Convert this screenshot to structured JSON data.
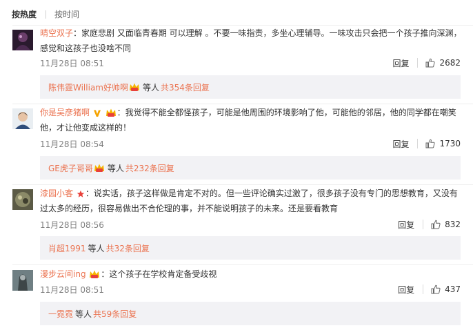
{
  "sort": {
    "hot_label": "按热度",
    "time_label": "按时间"
  },
  "comments": [
    {
      "user": "晴空双子",
      "text": "家庭悲剧 又面临青春期 可以理解 。不要一味指责，多坐心理辅导。一味攻击只会把一个孩子推向深渊，感觉和这孩子也没啥不同",
      "time": "11月28日 08:51",
      "reply_label": "回复",
      "likes": "2682",
      "sub": {
        "user": "陈伟霆William好帅啊",
        "mid": "等人",
        "count": "共354条回复"
      }
    },
    {
      "user": "你是吴彦猪啊",
      "text": "我觉得不能全都怪孩子，可能是他周围的环境影响了他，可能他的邻居，他的同学都在嘲笑他，才让他变成这样的！",
      "time": "11月28日 08:54",
      "reply_label": "回复",
      "likes": "1730",
      "sub": {
        "user": "GE虎子哥哥",
        "mid": "等人",
        "count": "共232条回复"
      }
    },
    {
      "user": "漆园小客",
      "text": "说实话，孩子这样做是肯定不对的。但一些评论确实过激了，很多孩子没有专门的思想教育，又没有过太多的经历，很容易做出不合伦理的事，并不能说明孩子的未来。还是要看教育",
      "time": "11月28日 08:56",
      "reply_label": "回复",
      "likes": "832",
      "sub": {
        "user": "肖超1991",
        "mid": "等人",
        "count": "共32条回复"
      }
    },
    {
      "user": "漫步云间ing",
      "text": "这个孩子在学校肯定备受歧视",
      "time": "11月28日 08:51",
      "reply_label": "回复",
      "likes": "437",
      "sub": {
        "user": "一霓霓",
        "mid": "等人",
        "count": "共59条回复"
      }
    }
  ],
  "colors": {
    "username": "#eb7350",
    "subbox_bg": "#f2f2f5",
    "time": "#808080"
  },
  "icons": {
    "like": "thumbs-up-icon",
    "vip": "vip-member-icon",
    "verified": "verified-v-icon",
    "star": "star-icon"
  }
}
